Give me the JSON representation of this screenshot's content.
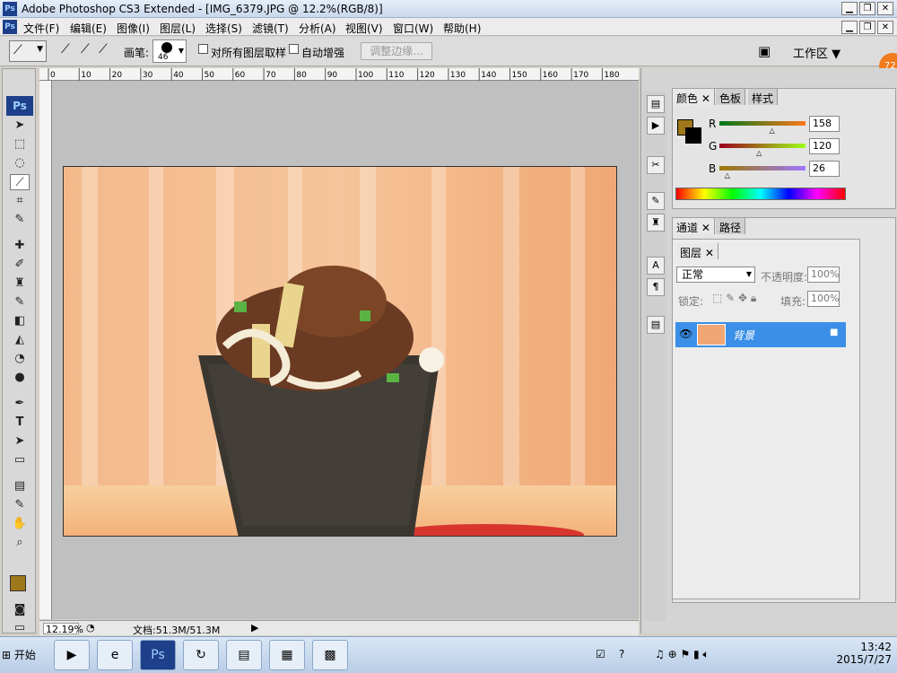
{
  "window": {
    "title": "Adobe Photoshop CS3 Extended - [IMG_6379.JPG @ 12.2%(RGB/8)]",
    "ps_icon": "Ps"
  },
  "menu": [
    "文件(F)",
    "编辑(E)",
    "图像(I)",
    "图层(L)",
    "选择(S)",
    "滤镜(T)",
    "分析(A)",
    "视图(V)",
    "窗口(W)",
    "帮助(H)"
  ],
  "options": {
    "brush_label": "画笔:",
    "brush_size": "46",
    "sample_all_layers": "对所有图层取样",
    "auto_enhance": "自动增强",
    "refine_edge": "调整边缘...",
    "workspace": "工作区"
  },
  "ruler_ticks": [
    "0",
    "10",
    "20",
    "30",
    "40",
    "50",
    "60",
    "70",
    "80",
    "90",
    "100",
    "110",
    "120",
    "130",
    "140",
    "150",
    "160",
    "170",
    "180"
  ],
  "toolbox": {
    "logo": "Ps"
  },
  "status": {
    "zoom": "12.19%",
    "doc": "文档:51.3M/51.3M"
  },
  "color_panel": {
    "tabs": [
      "颜色",
      "色板",
      "样式"
    ],
    "r_label": "R",
    "g_label": "G",
    "b_label": "B",
    "r": 158,
    "g": 120,
    "b": 26,
    "r_text": "158",
    "g_text": "120",
    "b_text": "26",
    "fg": "#9e781a"
  },
  "channel_panel": {
    "tabs": [
      "通道",
      "路径"
    ]
  },
  "layers_panel": {
    "tab": "图层",
    "blend": "正常",
    "opacity_label": "不透明度:",
    "opacity": "100%",
    "lock_label": "锁定:",
    "fill_label": "填充:",
    "fill": "100%",
    "layer_name": "背景"
  },
  "badge": "72",
  "taskbar": {
    "start": "开始",
    "time": "13:42",
    "date": "2015/7/27"
  },
  "colors": {
    "accent": "#3b8fe6"
  }
}
